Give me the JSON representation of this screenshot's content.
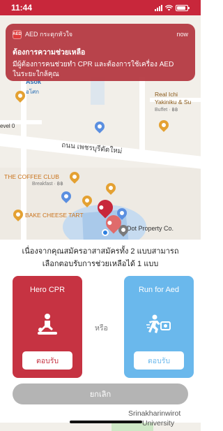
{
  "status_bar": {
    "time": "11:44",
    "accent": "#c8273b"
  },
  "notification": {
    "app_name": "AED กระตุกหัวใจ",
    "app_icon_text": "AED",
    "time": "now",
    "title": "ต้องการความช่วยเหลือ",
    "line1": "มีผู้ต้องการคนช่วยทำ CPR และต้องการใช้เครื่อง AED",
    "line2": "ในระยะใกล้คุณ"
  },
  "map": {
    "asok": "Asok",
    "asok_sub": "อโศก",
    "real_ichi": "Real Ichi",
    "real_ichi_2": "Yakiniku & Su",
    "real_ichi_sub": "Buffet · ฿฿",
    "level": "evel 0",
    "road": "ถนน เพชรบุรีตัดใหม่",
    "coffee_club": "THE COFFEE CLUB",
    "coffee_club_sub": "Breakfast · ฿฿",
    "bake_cheese": "BAKE CHEESE TART",
    "dot_property": "Dot Property Co.",
    "uni_1": "Srinakharinwirot",
    "uni_2": "University"
  },
  "sheet": {
    "message_line1": "เนื่องจากคุณสมัครอาสาสมัครทั้ง 2 แบบสามารถ",
    "message_line2": "เลือกตอบรับการช่วยเหลือได้ 1 แบบ",
    "or_label": "หรือ",
    "cancel_label": "ยกเลิก",
    "cards": [
      {
        "title": "Hero CPR",
        "button": "ตอบรับ",
        "icon": "cpr-icon",
        "color": "#c63342"
      },
      {
        "title": "Run for Aed",
        "button": "ตอบรับ",
        "icon": "run-aed-icon",
        "color": "#6ab8ec"
      }
    ]
  }
}
